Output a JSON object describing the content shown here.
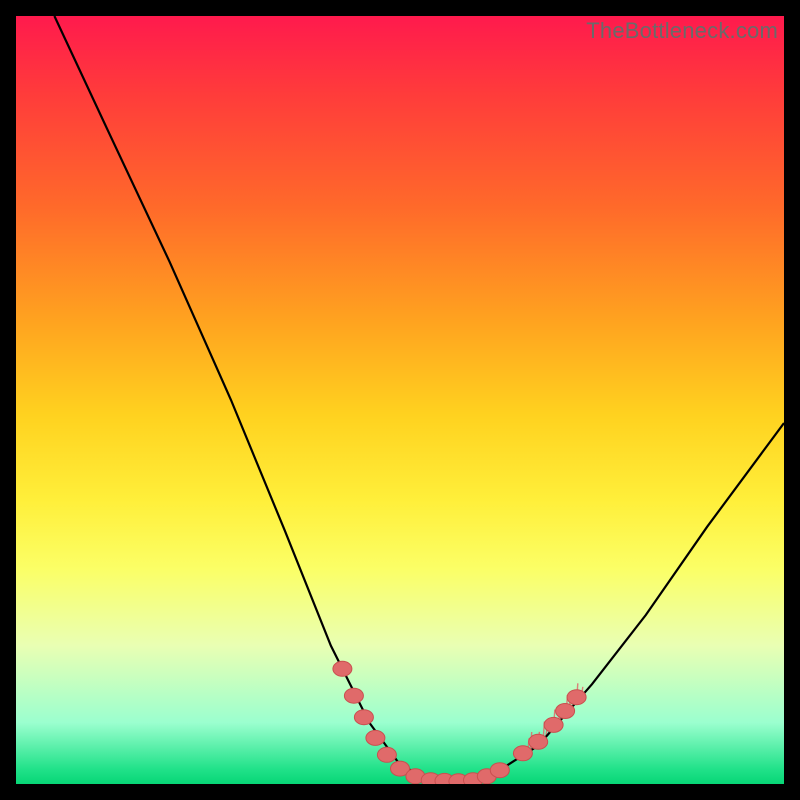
{
  "watermark": "TheBottleneck.com",
  "colors": {
    "dot": "#e06a6a",
    "dot_stroke": "#c94f4f",
    "curve": "#000000"
  },
  "chart_data": {
    "type": "line",
    "title": "",
    "xlabel": "",
    "ylabel": "",
    "xlim": [
      0,
      100
    ],
    "ylim": [
      0,
      100
    ],
    "curve_points": [
      {
        "x": 5.0,
        "y": 100.0
      },
      {
        "x": 12.0,
        "y": 85.0
      },
      {
        "x": 20.0,
        "y": 68.0
      },
      {
        "x": 28.0,
        "y": 50.0
      },
      {
        "x": 35.0,
        "y": 33.0
      },
      {
        "x": 41.0,
        "y": 18.0
      },
      {
        "x": 46.0,
        "y": 8.0
      },
      {
        "x": 50.0,
        "y": 2.5
      },
      {
        "x": 54.0,
        "y": 0.5
      },
      {
        "x": 58.0,
        "y": 0.4
      },
      {
        "x": 62.0,
        "y": 1.2
      },
      {
        "x": 68.0,
        "y": 5.0
      },
      {
        "x": 75.0,
        "y": 13.0
      },
      {
        "x": 82.0,
        "y": 22.0
      },
      {
        "x": 90.0,
        "y": 33.5
      },
      {
        "x": 100.0,
        "y": 47.0
      }
    ],
    "series": [
      {
        "name": "dots",
        "points": [
          {
            "x": 42.5,
            "y": 15.0
          },
          {
            "x": 44.0,
            "y": 11.5
          },
          {
            "x": 45.3,
            "y": 8.7
          },
          {
            "x": 46.8,
            "y": 6.0
          },
          {
            "x": 48.3,
            "y": 3.8
          },
          {
            "x": 50.0,
            "y": 2.0
          },
          {
            "x": 52.0,
            "y": 1.0
          },
          {
            "x": 54.0,
            "y": 0.5
          },
          {
            "x": 55.8,
            "y": 0.4
          },
          {
            "x": 57.6,
            "y": 0.35
          },
          {
            "x": 59.5,
            "y": 0.5
          },
          {
            "x": 61.3,
            "y": 1.0
          },
          {
            "x": 63.0,
            "y": 1.8
          },
          {
            "x": 66.0,
            "y": 4.0
          },
          {
            "x": 68.0,
            "y": 5.5
          },
          {
            "x": 70.0,
            "y": 7.7
          },
          {
            "x": 71.5,
            "y": 9.5
          },
          {
            "x": 73.0,
            "y": 11.3
          }
        ]
      }
    ]
  }
}
